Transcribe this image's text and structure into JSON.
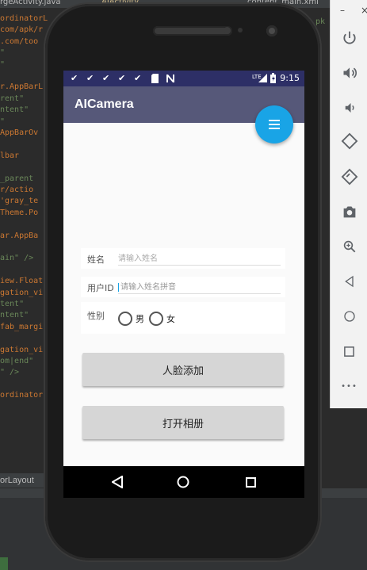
{
  "ide": {
    "tabs": [
      "rgeActivity.java",
      "AIActivity",
      "content_main.xml"
    ],
    "code_lines": [
      "ordinatorLa",
      "com/apk/r",
      ".com/too",
      "\"",
      "\"",
      "",
      "r.AppBarL",
      "rent\"",
      "ntent\"",
      "\"",
      "AppBarOv",
      "",
      "lbar",
      "",
      "_parent",
      "r/actio",
      "'gray_te",
      "Theme.Po",
      "",
      "ar.AppBa",
      "",
      "ain\" />",
      "",
      "iew.Float",
      "gation_vi",
      "tent\"",
      "ntent\"",
      "fab_margi",
      "",
      "gation_vi",
      "om|end\"",
      "\" />",
      "",
      "ordinator"
    ],
    "right_fragment": "pk",
    "status_text": "orLayout"
  },
  "toolbar": {
    "close_glyph": "×",
    "minimize_glyph": "–",
    "buttons": [
      "power-icon",
      "volume-up-icon",
      "volume-down-icon",
      "rotate-left-icon",
      "rotate-right-icon",
      "camera-icon",
      "zoom-icon",
      "back-icon",
      "home-icon",
      "overview-icon",
      "more-icon"
    ],
    "more_label": "•••"
  },
  "status_bar": {
    "time": "9:15",
    "notification_icons": [
      "check-icon",
      "check-icon",
      "check-icon",
      "check-icon",
      "check-icon",
      "sdcard-icon",
      "n-icon"
    ],
    "network_label": "LTE"
  },
  "app": {
    "title": "AICamera"
  },
  "form": {
    "name_label": "姓名",
    "name_placeholder": "请输入姓名",
    "user_id_label": "用户ID",
    "user_id_placeholder": "请输入姓名拼音",
    "gender_label": "性别",
    "gender_options": [
      "男",
      "女"
    ]
  },
  "buttons": {
    "add_face": "人脸添加",
    "open_album": "打开相册"
  },
  "colors": {
    "status_bar": "#2d2f66",
    "app_bar": "#565879",
    "fab": "#19a4e6",
    "button": "#d6d6d6"
  }
}
